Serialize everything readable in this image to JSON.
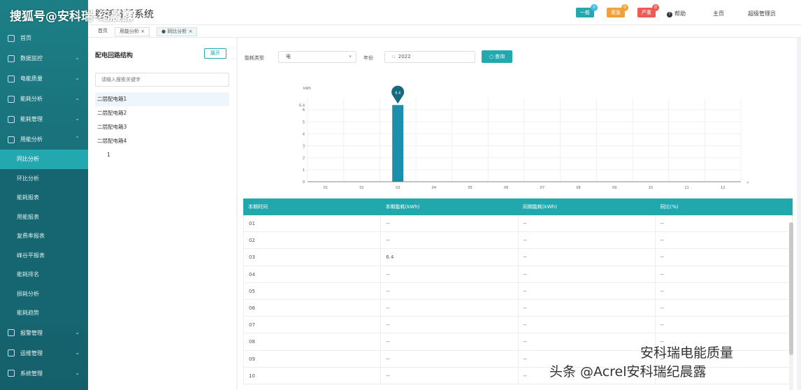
{
  "watermark_top": "搜狐号@安科瑞-纪晨露",
  "watermark_bottom_1": "安科瑞电能质量",
  "watermark_bottom_2": "头条 @Acrel安科瑞纪晨露",
  "header": {
    "title": "能耗分析系统",
    "badges": [
      {
        "label": "一般",
        "count": "0",
        "color": "#23a8b0"
      },
      {
        "label": "紧急",
        "count": "0",
        "color": "#f0a23a"
      },
      {
        "label": "严重",
        "count": "0",
        "color": "#ec5b56"
      }
    ],
    "help": "帮助",
    "home": "主页",
    "user": "超级管理员"
  },
  "breadcrumbs": [
    "首页",
    "用能分析",
    "同比分析"
  ],
  "sidebar": {
    "items": [
      {
        "label": "首页",
        "expandable": false
      },
      {
        "label": "数据监控",
        "expandable": true
      },
      {
        "label": "电能质量",
        "expandable": true
      },
      {
        "label": "能耗分析",
        "expandable": true
      },
      {
        "label": "能耗管理",
        "expandable": true
      },
      {
        "label": "用能分析",
        "expandable": true
      }
    ],
    "subitems": [
      {
        "label": "同比分析",
        "active": true
      },
      {
        "label": "环比分析",
        "active": false
      },
      {
        "label": "能耗报表",
        "active": false
      },
      {
        "label": "用能报表",
        "active": false
      },
      {
        "label": "复费率报表",
        "active": false
      },
      {
        "label": "峰谷平报表",
        "active": false
      },
      {
        "label": "能耗排名",
        "active": false
      },
      {
        "label": "损耗分析",
        "active": false
      },
      {
        "label": "能耗趋势",
        "active": false
      }
    ],
    "bottom_items": [
      {
        "label": "报警管理",
        "expandable": true
      },
      {
        "label": "运维管理",
        "expandable": true
      },
      {
        "label": "系统管理",
        "expandable": true
      }
    ]
  },
  "tree": {
    "title": "配电回路结构",
    "button": "展开",
    "search_placeholder": "请输入搜索关键字",
    "nodes": [
      "二层配电箱1",
      "二层配电箱2",
      "二层配电箱3",
      "二层配电箱4",
      "1"
    ]
  },
  "filters": {
    "type_label": "能耗类型",
    "type_value": "电",
    "year_label": "年份",
    "year_value": "2022",
    "query": "查询"
  },
  "chart_data": {
    "type": "bar",
    "ylabel": "kWh",
    "categories": [
      "01",
      "02",
      "03",
      "04",
      "05",
      "06",
      "07",
      "08",
      "09",
      "10",
      "11",
      "12"
    ],
    "series": [
      {
        "values": [
          0,
          0,
          6.4,
          0,
          0,
          0,
          0,
          0,
          0,
          0,
          0,
          0
        ],
        "color": "#1b8fab"
      }
    ],
    "ylim": [
      0,
      7
    ],
    "yticks": [
      "0",
      "1",
      "2",
      "3",
      "4",
      "5",
      "6",
      "6.4"
    ],
    "marker": {
      "category": "03",
      "label": "6.4"
    }
  },
  "table": {
    "columns": [
      "本期时间",
      "本期能耗(kWh)",
      "同期能耗(kWh)",
      "同比(%)"
    ],
    "rows": [
      [
        "01",
        "--",
        "--",
        "--"
      ],
      [
        "02",
        "--",
        "--",
        "--"
      ],
      [
        "03",
        "6.4",
        "--",
        "--"
      ],
      [
        "04",
        "--",
        "--",
        "--"
      ],
      [
        "05",
        "--",
        "--",
        "--"
      ],
      [
        "06",
        "--",
        "--",
        "--"
      ],
      [
        "07",
        "--",
        "--",
        "--"
      ],
      [
        "08",
        "--",
        "--",
        "--"
      ],
      [
        "09",
        "--",
        "--",
        "--"
      ],
      [
        "10",
        "--",
        "--",
        "--"
      ]
    ]
  }
}
